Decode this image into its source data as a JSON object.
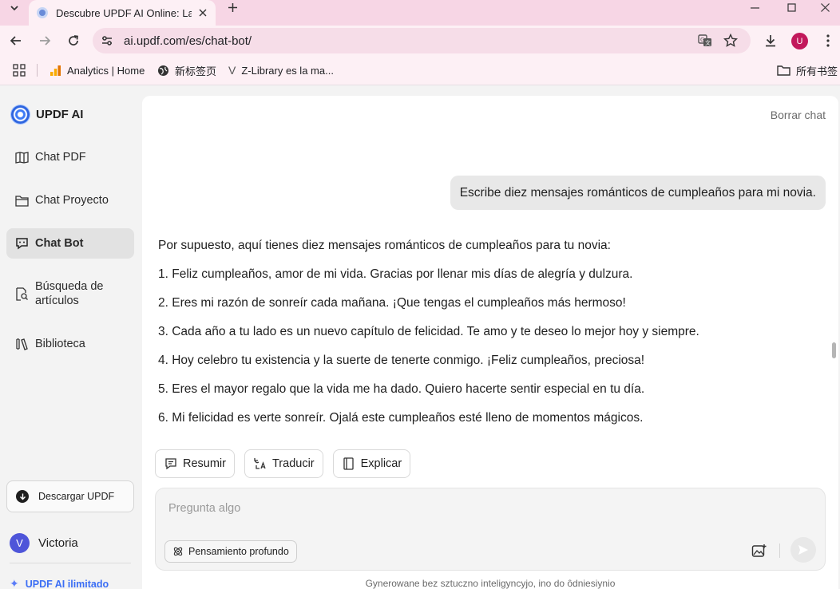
{
  "browser": {
    "tab_title": "Descubre UPDF AI Online: La",
    "url": "ai.updf.com/es/chat-bot/",
    "profile_initial": "U",
    "bookmarks": [
      "Analytics | Home",
      "新标签页",
      "Z-Library es la ma..."
    ],
    "all_bookmarks": "所有书签"
  },
  "sidebar": {
    "brand": "UPDF AI",
    "items": [
      {
        "label": "Chat PDF",
        "icon": "book-open-icon"
      },
      {
        "label": "Chat Proyecto",
        "icon": "folder-icon"
      },
      {
        "label": "Chat Bot",
        "icon": "chat-bot-icon"
      },
      {
        "label": "Búsqueda de artículos",
        "icon": "document-search-icon"
      },
      {
        "label": "Biblioteca",
        "icon": "library-icon"
      }
    ],
    "download_label": "Descargar UPDF",
    "user_initial": "V",
    "user_name": "Victoria",
    "upgrade_label": "UPDF AI ilimitado"
  },
  "chat": {
    "clear_label": "Borrar chat",
    "user_message": "Escribe diez mensajes románticos de cumpleaños para mi novia.",
    "intro": "Por supuesto, aquí tienes diez mensajes románticos de cumpleaños para tu novia:",
    "items": [
      "1.  Feliz cumpleaños, amor de mi vida. Gracias por llenar mis días de alegría y dulzura.",
      "2. Eres mi razón de sonreír cada mañana. ¡Que tengas el cumpleaños más hermoso!",
      "3. Cada año a tu lado es un nuevo capítulo de felicidad. Te amo y te deseo lo mejor hoy y siempre.",
      "4. Hoy celebro tu existencia y la suerte de tenerte conmigo. ¡Feliz cumpleaños, preciosa!",
      "5. Eres el mayor regalo que la vida me ha dado. Quiero hacerte sentir especial en tu día.",
      "6. Mi felicidad es verte sonreír. Ojalá este cumpleaños esté lleno de momentos mágicos."
    ],
    "actions": [
      "Resumir",
      "Traducir",
      "Explicar"
    ]
  },
  "composer": {
    "placeholder": "Pregunta algo",
    "deep_thinking_label": "Pensamiento profundo",
    "disclaimer": "Gynerowane bez sztuczno inteligyncyjo, ino do ôdniesiynio"
  }
}
